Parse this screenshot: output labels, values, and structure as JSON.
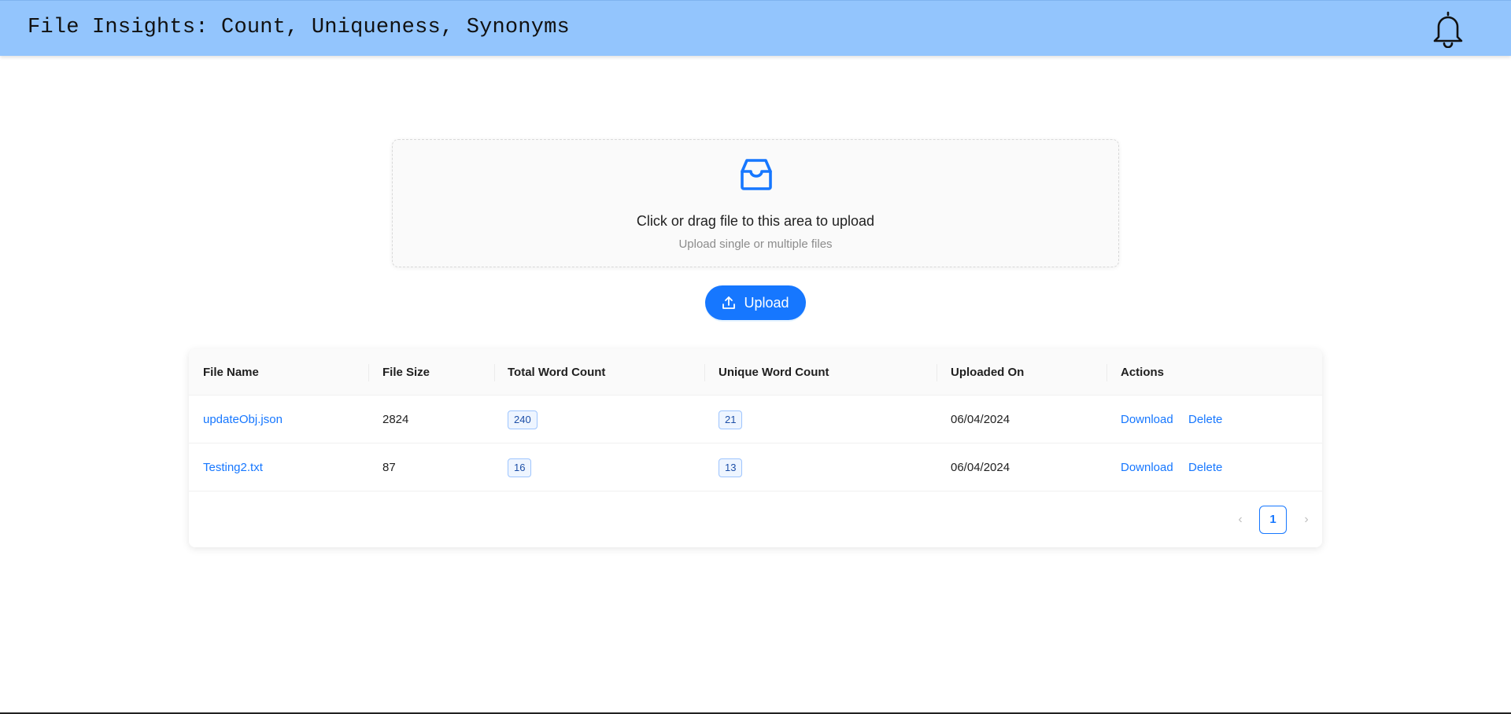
{
  "header": {
    "title": "File Insights: Count, Uniqueness, Synonyms",
    "bell_icon": "bell-icon"
  },
  "dropzone": {
    "icon": "inbox-icon",
    "text": "Click or drag file to this area to upload",
    "hint": "Upload single or multiple files"
  },
  "upload_button": {
    "icon": "upload-icon",
    "label": "Upload"
  },
  "table": {
    "columns": [
      "File Name",
      "File Size",
      "Total Word Count",
      "Unique Word Count",
      "Uploaded On",
      "Actions"
    ],
    "rows": [
      {
        "file_name": "updateObj.json",
        "file_size": "2824",
        "total_word_count": "240",
        "unique_word_count": "21",
        "uploaded_on": "06/04/2024",
        "download": "Download",
        "delete": "Delete"
      },
      {
        "file_name": "Testing2.txt",
        "file_size": "87",
        "total_word_count": "16",
        "unique_word_count": "13",
        "uploaded_on": "06/04/2024",
        "download": "Download",
        "delete": "Delete"
      }
    ]
  },
  "pagination": {
    "prev": "‹",
    "current_page": "1",
    "next": "›"
  },
  "colors": {
    "header_bg": "#93c5fd",
    "primary": "#1677ff",
    "tag_bg": "#eef5ff",
    "tag_border": "#9ec5fe"
  }
}
